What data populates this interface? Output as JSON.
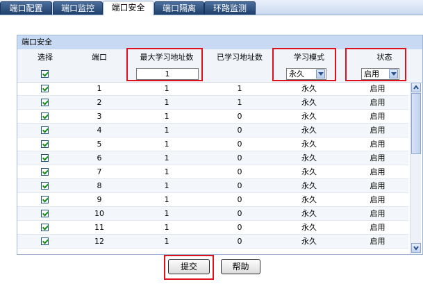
{
  "tabs": [
    {
      "label": "端口配置",
      "active": false
    },
    {
      "label": "端口监控",
      "active": false
    },
    {
      "label": "端口安全",
      "active": true
    },
    {
      "label": "端口隔离",
      "active": false
    },
    {
      "label": "环路监测",
      "active": false
    }
  ],
  "panel": {
    "title": "端口安全",
    "headers": {
      "select": "选择",
      "port": "端口",
      "max_learn": "最大学习地址数",
      "learned": "已学习地址数",
      "mode": "学习模式",
      "status": "状态"
    },
    "controls": {
      "select_all_checked": true,
      "max_learn_value": "1",
      "mode_value": "永久",
      "status_value": "启用"
    },
    "rows": [
      {
        "port": "1",
        "max": "1",
        "learned": "1",
        "mode": "永久",
        "status": "启用"
      },
      {
        "port": "2",
        "max": "1",
        "learned": "1",
        "mode": "永久",
        "status": "启用"
      },
      {
        "port": "3",
        "max": "1",
        "learned": "0",
        "mode": "永久",
        "status": "启用"
      },
      {
        "port": "4",
        "max": "1",
        "learned": "0",
        "mode": "永久",
        "status": "启用"
      },
      {
        "port": "5",
        "max": "1",
        "learned": "0",
        "mode": "永久",
        "status": "启用"
      },
      {
        "port": "6",
        "max": "1",
        "learned": "0",
        "mode": "永久",
        "status": "启用"
      },
      {
        "port": "7",
        "max": "1",
        "learned": "0",
        "mode": "永久",
        "status": "启用"
      },
      {
        "port": "8",
        "max": "1",
        "learned": "0",
        "mode": "永久",
        "status": "启用"
      },
      {
        "port": "9",
        "max": "1",
        "learned": "0",
        "mode": "永久",
        "status": "启用"
      },
      {
        "port": "10",
        "max": "1",
        "learned": "0",
        "mode": "永久",
        "status": "启用"
      },
      {
        "port": "11",
        "max": "1",
        "learned": "0",
        "mode": "永久",
        "status": "启用"
      },
      {
        "port": "12",
        "max": "1",
        "learned": "0",
        "mode": "永久",
        "status": "启用"
      }
    ]
  },
  "buttons": {
    "submit": "提交",
    "help": "帮助"
  },
  "colors": {
    "highlight": "#e0101a",
    "tab_active_bg": "#ffffff",
    "tab_bg": "#2d5080"
  }
}
